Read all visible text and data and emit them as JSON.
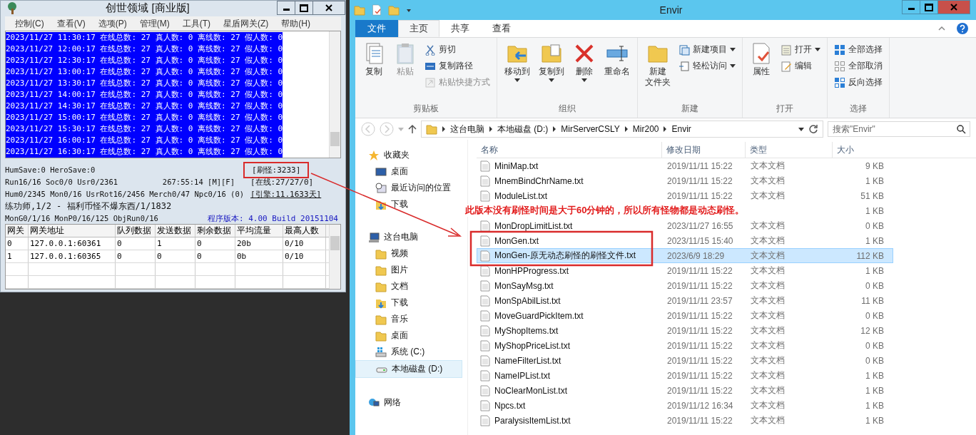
{
  "server_window": {
    "title": "创世领域 [商业版]",
    "menu": [
      "控制(C)",
      "查看(V)",
      "选项(P)",
      "管理(M)",
      "工具(T)",
      "星盾网关(Z)",
      "帮助(H)"
    ],
    "log": {
      "selected": true,
      "lines": [
        "2023/11/27 11:30:17 在线总数: 27 真人数: 0 离线数: 27 假人数: 0",
        "2023/11/27 12:00:17 在线总数: 27 真人数: 0 离线数: 27 假人数: 0",
        "2023/11/27 12:30:17 在线总数: 27 真人数: 0 离线数: 27 假人数: 0",
        "2023/11/27 13:00:17 在线总数: 27 真人数: 0 离线数: 27 假人数: 0",
        "2023/11/27 13:30:17 在线总数: 27 真人数: 0 离线数: 27 假人数: 0",
        "2023/11/27 14:00:17 在线总数: 27 真人数: 0 离线数: 27 假人数: 0",
        "2023/11/27 14:30:17 在线总数: 27 真人数: 0 离线数: 27 假人数: 0",
        "2023/11/27 15:00:17 在线总数: 27 真人数: 0 离线数: 27 假人数: 0",
        "2023/11/27 15:30:17 在线总数: 27 真人数: 0 离线数: 27 假人数: 0",
        "2023/11/27 16:00:17 在线总数: 27 真人数: 0 离线数: 27 假人数: 0",
        "2023/11/27 16:30:17 在线总数: 27 真人数: 0 离线数: 27 假人数: 0"
      ]
    },
    "status": {
      "hum_save": "HumSave:0 HeroSave:0",
      "run": "Run16/16 Soc0/0 Usr0/2361",
      "uptime": "267:55:14 [M][F]",
      "counts": "Hum0/2345 Mon0/16 UsrRot16/2456 Merch0/47 Npc0/16 (0)",
      "map": "练功师,1/2 - 福利币怪不爆东西/1/1832",
      "objects": "MonG0/1/16 MonP0/16/125 ObjRun0/16",
      "spawn": "[刷怪:3233]",
      "online": "[在线:27/27/0]",
      "engine": "[引擎:11.1633天]",
      "version": "程序版本: 4.00 Build 20151104"
    },
    "gateway_table": {
      "columns": [
        "网关",
        "网关地址",
        "队列数据",
        "发送数据",
        "剩余数据",
        "平均流量",
        "最高人数"
      ],
      "rows": [
        [
          "0",
          "127.0.0.1:60361",
          "0",
          "1",
          "0",
          "20b",
          "0/10"
        ],
        [
          "1",
          "127.0.0.1:60365",
          "0",
          "0",
          "0",
          "0b",
          "0/10"
        ]
      ]
    }
  },
  "explorer": {
    "title": "Envir",
    "tabs": [
      {
        "label": "文件",
        "kind": "file",
        "selected": false
      },
      {
        "label": "主页",
        "kind": "tab",
        "selected": true
      },
      {
        "label": "共享",
        "kind": "tab",
        "selected": false
      },
      {
        "label": "查看",
        "kind": "tab",
        "selected": false
      }
    ],
    "ribbon": [
      {
        "label": "剪贴板",
        "items": [
          {
            "lines": [
              "复制"
            ],
            "kind": "large",
            "disabled": false
          },
          {
            "lines": [
              "粘贴"
            ],
            "kind": "large",
            "disabled": true
          },
          {
            "lines": [
              "剪切"
            ],
            "kind": "small",
            "disabled": false
          },
          {
            "lines": [
              "复制路径"
            ],
            "kind": "small",
            "disabled": false
          },
          {
            "lines": [
              "粘贴快捷方式"
            ],
            "kind": "small",
            "disabled": true
          }
        ]
      },
      {
        "label": "组织",
        "items": [
          {
            "lines": [
              "移动到"
            ],
            "kind": "large",
            "disabled": false,
            "dropdown": true
          },
          {
            "lines": [
              "复制到"
            ],
            "kind": "large",
            "disabled": false,
            "dropdown": true
          },
          {
            "lines": [
              "删除"
            ],
            "kind": "large",
            "disabled": false,
            "dropdown": true
          },
          {
            "lines": [
              "重命名"
            ],
            "kind": "large",
            "disabled": false,
            "dropdown": false
          }
        ]
      },
      {
        "label": "新建",
        "items": [
          {
            "lines": [
              "新建",
              "文件夹"
            ],
            "kind": "large",
            "disabled": false,
            "dropdown": false
          },
          {
            "lines": [
              "新建项目"
            ],
            "kind": "small",
            "disabled": false,
            "dropdown": true
          },
          {
            "lines": [
              "轻松访问"
            ],
            "kind": "small",
            "disabled": false,
            "dropdown": true
          }
        ]
      },
      {
        "label": "打开",
        "items": [
          {
            "lines": [
              "属性"
            ],
            "kind": "large",
            "disabled": false,
            "dropdown": false
          },
          {
            "lines": [
              "打开"
            ],
            "kind": "small",
            "disabled": false,
            "dropdown": true
          },
          {
            "lines": [
              "编辑"
            ],
            "kind": "small",
            "disabled": false,
            "dropdown": false
          }
        ]
      },
      {
        "label": "选择",
        "items": [
          {
            "lines": [
              "全部选择"
            ],
            "kind": "small",
            "disabled": false
          },
          {
            "lines": [
              "全部取消"
            ],
            "kind": "small",
            "disabled": false
          },
          {
            "lines": [
              "反向选择"
            ],
            "kind": "small",
            "disabled": false
          }
        ]
      }
    ],
    "address": [
      "这台电脑",
      "本地磁盘 (D:)",
      "MirServerCSLY",
      "Mir200",
      "Envir"
    ],
    "search": {
      "placeholder": "搜索\"Envir\""
    },
    "sidebar": [
      {
        "label": "收藏夹",
        "kind": "favorites",
        "selected": false,
        "children": [
          {
            "label": "桌面",
            "kind": "desktop",
            "selected": false
          },
          {
            "label": "最近访问的位置",
            "kind": "recent",
            "selected": false
          },
          {
            "label": "下载",
            "kind": "download",
            "selected": false
          }
        ]
      },
      {
        "label": "这台电脑",
        "kind": "computer",
        "selected": false,
        "children": [
          {
            "label": "视频",
            "kind": "folder",
            "selected": false
          },
          {
            "label": "图片",
            "kind": "folder",
            "selected": false
          },
          {
            "label": "文档",
            "kind": "folder",
            "selected": false
          },
          {
            "label": "下载",
            "kind": "download",
            "selected": false
          },
          {
            "label": "音乐",
            "kind": "folder",
            "selected": false
          },
          {
            "label": "桌面",
            "kind": "folder",
            "selected": false
          },
          {
            "label": "系统 (C:)",
            "kind": "system",
            "selected": false
          },
          {
            "label": "本地磁盘 (D:)",
            "kind": "drive",
            "selected": true
          }
        ]
      },
      {
        "label": "网络",
        "kind": "network",
        "selected": false
      }
    ],
    "columns": [
      "名称",
      "修改日期",
      "类型",
      "大小"
    ],
    "files": [
      {
        "name": "MiniMap.txt",
        "date": "2019/11/11 15:22",
        "type": "文本文档",
        "size": "9 KB",
        "selected": false
      },
      {
        "name": "MnemBindChrName.txt",
        "date": "2019/11/11 15:22",
        "type": "文本文档",
        "size": "1 KB",
        "selected": false
      },
      {
        "name": "ModuleList.txt",
        "date": "2019/11/11 15:22",
        "type": "文本文档",
        "size": "51 KB",
        "selected": false
      },
      {
        "size": "1 KB",
        "selected": false
      },
      {
        "name": "MonDropLimitList.txt",
        "date": "2023/11/27 16:55",
        "type": "文本文档",
        "size": "0 KB",
        "selected": false
      },
      {
        "name": "MonGen.txt",
        "date": "2023/11/15 15:40",
        "type": "文本文档",
        "size": "1 KB",
        "selected": false
      },
      {
        "name": "MonGen-原无动态刷怪的刷怪文件.txt",
        "date": "2023/6/9 18:29",
        "type": "文本文档",
        "size": "112 KB",
        "selected": true
      },
      {
        "name": "MonHPProgress.txt",
        "date": "2019/11/11 15:22",
        "type": "文本文档",
        "size": "1 KB",
        "selected": false
      },
      {
        "name": "MonSayMsg.txt",
        "date": "2019/11/11 15:22",
        "type": "文本文档",
        "size": "0 KB",
        "selected": false
      },
      {
        "name": "MonSpAbilList.txt",
        "date": "2019/11/11 23:57",
        "type": "文本文档",
        "size": "11 KB",
        "selected": false
      },
      {
        "name": "MoveGuardPickItem.txt",
        "date": "2019/11/11 15:22",
        "type": "文本文档",
        "size": "0 KB",
        "selected": false
      },
      {
        "name": "MyShopItems.txt",
        "date": "2019/11/11 15:22",
        "type": "文本文档",
        "size": "12 KB",
        "selected": false
      },
      {
        "name": "MyShopPriceList.txt",
        "date": "2019/11/11 15:22",
        "type": "文本文档",
        "size": "0 KB",
        "selected": false
      },
      {
        "name": "NameFilterList.txt",
        "date": "2019/11/11 15:22",
        "type": "文本文档",
        "size": "0 KB",
        "selected": false
      },
      {
        "name": "NameIPList.txt",
        "date": "2019/11/11 15:22",
        "type": "文本文档",
        "size": "1 KB",
        "selected": false
      },
      {
        "name": "NoClearMonList.txt",
        "date": "2019/11/11 15:22",
        "type": "文本文档",
        "size": "1 KB",
        "selected": false
      },
      {
        "name": "Npcs.txt",
        "date": "2019/11/12 16:34",
        "type": "文本文档",
        "size": "1 KB",
        "selected": false
      },
      {
        "name": "ParalysisItemList.txt",
        "date": "2019/11/11 15:22",
        "type": "文本文档",
        "size": "1 KB",
        "selected": false
      }
    ]
  },
  "annotation": {
    "text": "此版本没有刷怪时间是大于60分钟的，所以所有怪物都是动态刷怪。"
  }
}
